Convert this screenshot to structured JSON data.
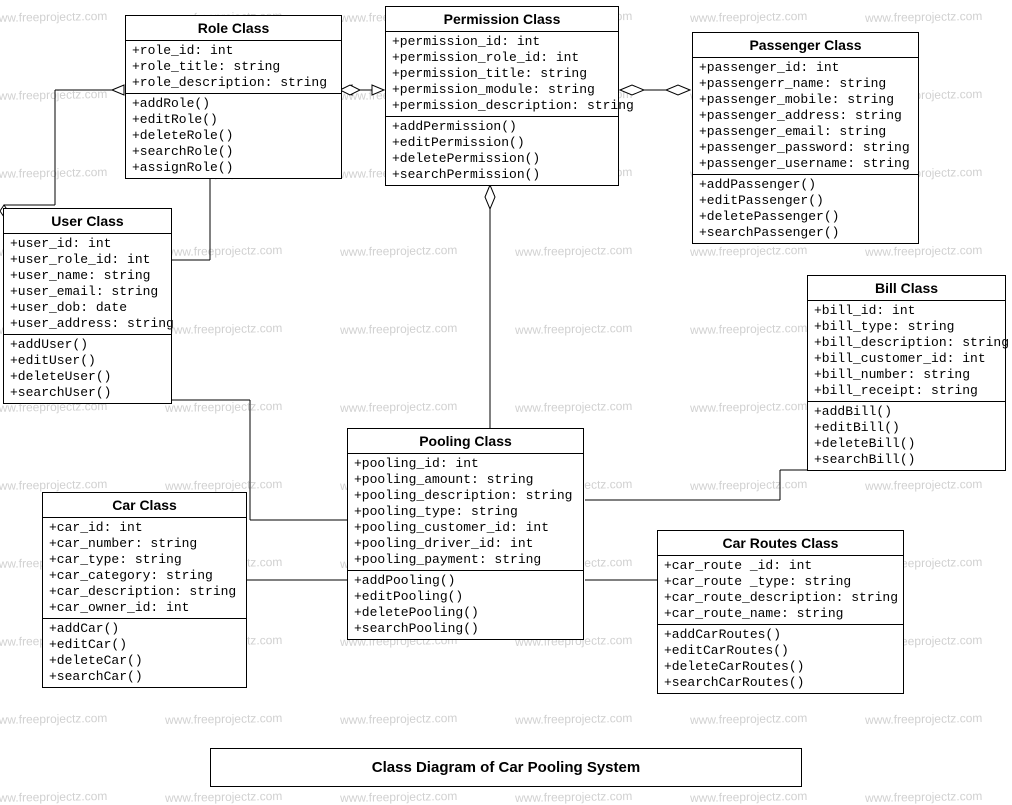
{
  "title": "Class Diagram of Car Pooling System",
  "watermark_text": "www.freeprojectz.com",
  "classes": {
    "role": {
      "name": "Role Class",
      "attrs": [
        "+role_id: int",
        "+role_title: string",
        "+role_description: string"
      ],
      "ops": [
        "+addRole()",
        "+editRole()",
        "+deleteRole()",
        "+searchRole()",
        "+assignRole()"
      ]
    },
    "permission": {
      "name": "Permission Class",
      "attrs": [
        "+permission_id: int",
        "+permission_role_id: int",
        "+permission_title: string",
        "+permission_module: string",
        "+permission_description: string"
      ],
      "ops": [
        "+addPermission()",
        "+editPermission()",
        "+deletePermission()",
        "+searchPermission()"
      ]
    },
    "passenger": {
      "name": "Passenger Class",
      "attrs": [
        "+passenger_id: int",
        "+passengerr_name: string",
        "+passenger_mobile: string",
        "+passenger_address: string",
        "+passenger_email: string",
        "+passenger_password: string",
        "+passenger_username: string"
      ],
      "ops": [
        "+addPassenger()",
        "+editPassenger()",
        "+deletePassenger()",
        "+searchPassenger()"
      ]
    },
    "user": {
      "name": "User Class",
      "attrs": [
        "+user_id: int",
        "+user_role_id: int",
        "+user_name: string",
        "+user_email: string",
        "+user_dob: date",
        "+user_address: string"
      ],
      "ops": [
        "+addUser()",
        "+editUser()",
        "+deleteUser()",
        "+searchUser()"
      ]
    },
    "bill": {
      "name": "Bill Class",
      "attrs": [
        "+bill_id: int",
        "+bill_type: string",
        "+bill_description: string",
        "+bill_customer_id: int",
        "+bill_number: string",
        "+bill_receipt: string"
      ],
      "ops": [
        "+addBill()",
        "+editBill()",
        "+deleteBill()",
        "+searchBill()"
      ]
    },
    "pooling": {
      "name": "Pooling Class",
      "attrs": [
        "+pooling_id: int",
        "+pooling_amount: string",
        "+pooling_description: string",
        "+pooling_type: string",
        "+pooling_customer_id: int",
        "+pooling_driver_id: int",
        "+pooling_payment: string"
      ],
      "ops": [
        "+addPooling()",
        "+editPooling()",
        "+deletePooling()",
        "+searchPooling()"
      ]
    },
    "car": {
      "name": "Car Class",
      "attrs": [
        "+car_id: int",
        "+car_number: string",
        "+car_type: string",
        "+car_category: string",
        "+car_description: string",
        "+car_owner_id: int"
      ],
      "ops": [
        "+addCar()",
        "+editCar()",
        "+deleteCar()",
        "+searchCar()"
      ]
    },
    "carroutes": {
      "name": "Car Routes Class",
      "attrs": [
        "+car_route _id: int",
        "+car_route _type: string",
        "+car_route_description: string",
        "+car_route_name: string"
      ],
      "ops": [
        "+addCarRoutes()",
        "+editCarRoutes()",
        "+deleteCarRoutes()",
        "+searchCarRoutes()"
      ]
    }
  }
}
